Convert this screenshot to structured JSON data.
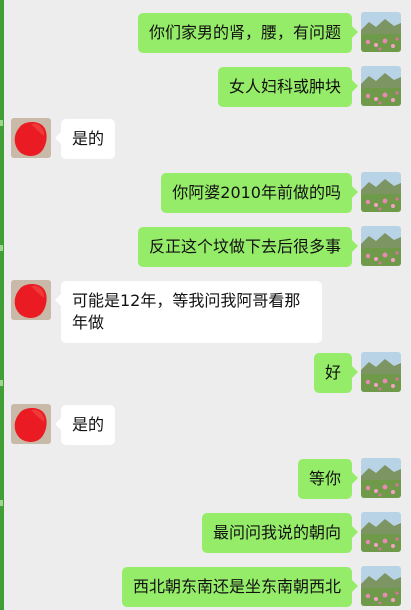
{
  "colors": {
    "page_background": "#ededed",
    "outgoing_bubble": "#95ec69",
    "incoming_bubble": "#ffffff",
    "left_edge_strip": "#3f9f36"
  },
  "avatars": {
    "self": "landscape-photo-avatar",
    "contact": "red-redacted-avatar"
  },
  "messages": [
    {
      "side": "out",
      "text": "你们家男的肾，腰，有问题"
    },
    {
      "side": "out",
      "text": "女人妇科或肿块"
    },
    {
      "side": "in",
      "text": "是的"
    },
    {
      "side": "out",
      "text": "你阿婆2010年前做的吗"
    },
    {
      "side": "out",
      "text": "反正这个坟做下去后很多事"
    },
    {
      "side": "in",
      "text": "可能是12年，等我问我阿哥看那年做"
    },
    {
      "side": "out",
      "text": "好"
    },
    {
      "side": "in",
      "text": "是的"
    },
    {
      "side": "out",
      "text": "等你"
    },
    {
      "side": "out",
      "text": "最问问我说的朝向"
    },
    {
      "side": "out",
      "text": "西北朝东南还是坐东南朝西北"
    }
  ]
}
